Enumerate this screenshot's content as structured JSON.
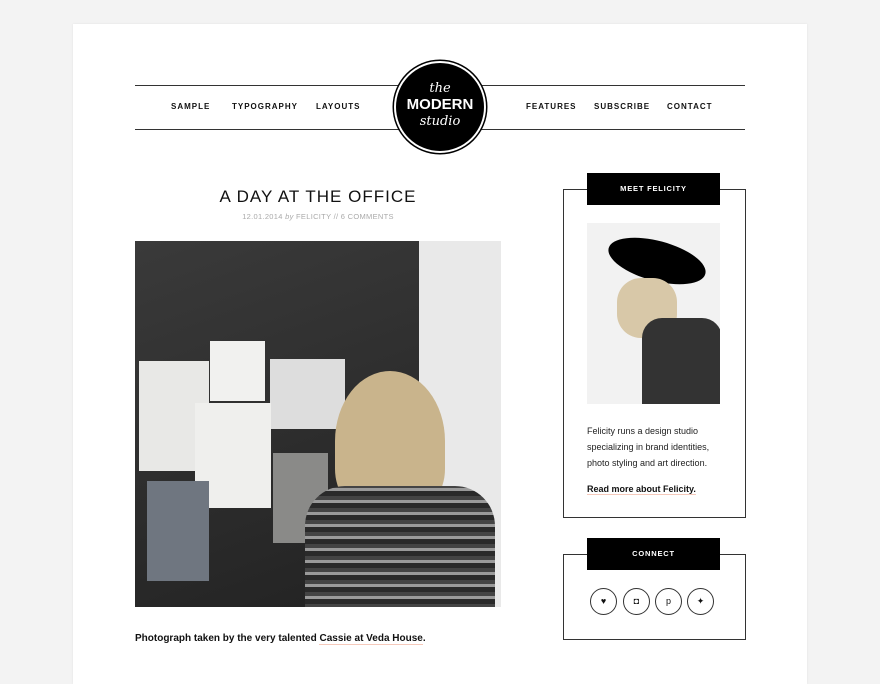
{
  "nav": {
    "left": [
      "SAMPLE",
      "TYPOGRAPHY",
      "LAYOUTS"
    ],
    "right": [
      "FEATURES",
      "SUBSCRIBE",
      "CONTACT"
    ]
  },
  "logo": {
    "line1": "the",
    "line2": "MODERN",
    "line3": "studio"
  },
  "post": {
    "title": "A DAY AT THE OFFICE",
    "date": "12.01.2014",
    "by": "by",
    "author": "FELICITY",
    "sep": "//",
    "comments": "6 COMMENTS",
    "caption_text": "Photograph taken by the very talented ",
    "caption_link": "Cassie at Veda House",
    "caption_end": "."
  },
  "sidebar": {
    "about_title": "MEET FELICITY",
    "bio": "Felicity runs a design studio specializing in brand identities, photo styling and art direction.",
    "read_more": "Read more about Felicity.",
    "connect_title": "CONNECT",
    "social": [
      {
        "icon": "heart-icon",
        "glyph": "♥"
      },
      {
        "icon": "instagram-icon",
        "glyph": "◘"
      },
      {
        "icon": "pinterest-icon",
        "glyph": "p"
      },
      {
        "icon": "twitter-icon",
        "glyph": "✦"
      }
    ]
  }
}
